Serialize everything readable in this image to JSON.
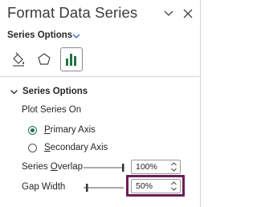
{
  "pane": {
    "title": "Format Data Series",
    "options_dropdown": "Series Options"
  },
  "tabs": [
    {
      "icon": "fill-line-icon",
      "selected": false
    },
    {
      "icon": "effects-icon",
      "selected": false
    },
    {
      "icon": "series-options-icon",
      "selected": true
    }
  ],
  "section": {
    "title": "Series Options",
    "plot_label": "Plot Series On",
    "radios": [
      {
        "label_pre": "",
        "label_ul": "P",
        "label_post": "rimary Axis",
        "selected": true
      },
      {
        "label_pre": "",
        "label_ul": "S",
        "label_post": "econdary Axis",
        "selected": false
      }
    ],
    "overlap": {
      "label_pre": "Series ",
      "label_ul": "O",
      "label_post": "verlap",
      "value": "100%"
    },
    "gap": {
      "label": "Gap Width",
      "value": "50%"
    }
  },
  "colors": {
    "accent": "#217346",
    "highlight": "#6b1f56"
  }
}
